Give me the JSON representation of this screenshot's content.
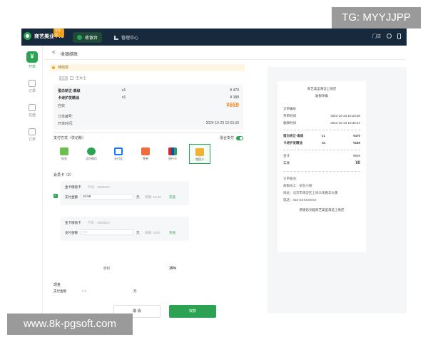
{
  "watermarks": {
    "top": "TG: MYYJJPP",
    "bottom": "www.8k-pgsoft.com"
  },
  "topbar": {
    "brand": "商艺美业 Pro",
    "brand_badge": "专业版",
    "tabs": [
      {
        "label": "收银台"
      },
      {
        "label": "管理中心"
      }
    ],
    "right_text": "门店"
  },
  "sidebar": {
    "items": [
      {
        "label": "开单"
      },
      {
        "label": "订单"
      },
      {
        "label": "充值"
      },
      {
        "label": "订单"
      }
    ]
  },
  "page": {
    "back": "<",
    "title": "收银结账",
    "notice": "待结款"
  },
  "member": {
    "tag": "散客",
    "name": "王女士"
  },
  "order": {
    "items": [
      {
        "name": "蛋白矫正-高级",
        "qty": "x1",
        "price": "¥ 470"
      },
      {
        "name": "卡诗护发精油",
        "qty": "x1",
        "price": "¥ 189"
      }
    ],
    "total_label": "应收",
    "total_value": "¥659",
    "order_no_label": "订单编号:",
    "time_label": "开单时间:",
    "time_value": "2024-10-23 10:23:30"
  },
  "payment": {
    "section_label": "支付方式（仅记账）",
    "mixed_label": "混合支付",
    "methods": [
      {
        "label": "现金"
      },
      {
        "label": "店内微信"
      },
      {
        "label": "支付宝"
      },
      {
        "label": "售券"
      },
      {
        "label": "银行卡"
      },
      {
        "label": "储值卡"
      }
    ]
  },
  "cards": {
    "section_label": "会员卡（2）",
    "list": [
      {
        "name": "金卡储值卡",
        "no_label": "卡号:",
        "no_value": "3463623",
        "amount_label": "支付金额",
        "amount_value": "10.59",
        "unit": "元",
        "balance_label": "余额:",
        "balance_value": "10.59",
        "fill": "充值"
      },
      {
        "name": "金卡储值卡",
        "no_label": "卡号:",
        "no_value": "3463623",
        "amount_label": "支付金额",
        "amount_value": "0.0",
        "unit": "元",
        "balance_label": "余额:",
        "balance_value": "1600",
        "fill": "充值"
      }
    ]
  },
  "cash": {
    "section_label": "现金",
    "amount_label": "支付金额",
    "amount_placeholder": "0.0",
    "unit": "元"
  },
  "buttons": {
    "cancel": "取 消",
    "pay": "收款"
  },
  "receipt": {
    "store": "商艺美型海淀上地店",
    "title": "收银单据",
    "order_no_label": "订单编号",
    "open_time_label": "开单时间",
    "open_time_value": "2024-10-23 10:23:30",
    "pay_time_label": "收款时间",
    "pay_time_value": "2024-10-23 10:30:42",
    "items": [
      {
        "name": "蛋白矫正-高级",
        "qty": "x1",
        "price": "¥470"
      },
      {
        "name": "卡诗护发精油",
        "qty": "X1",
        "price": "¥189"
      }
    ],
    "subtotal_label": "合计",
    "subtotal_value": "¥659",
    "paid_label": "实收",
    "paid_value": "¥0",
    "note_label": "订单备注:",
    "staff_line": "收银员工：前台小丽",
    "address_line": "地址：北京市海淀区上地三街嘉华大厦",
    "phone_line": "电话：010-XXXXXXXX",
    "thanks": "感谢您光临商艺美型海淀上地店"
  },
  "discount": {
    "label": "折扣",
    "value": "15%"
  }
}
